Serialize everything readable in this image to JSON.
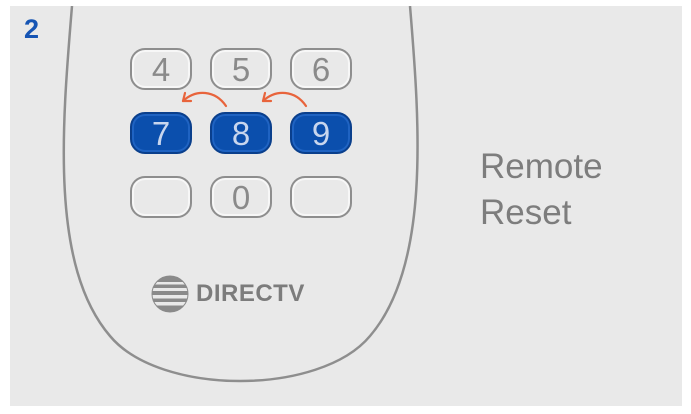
{
  "step": {
    "number": "2"
  },
  "keypad": {
    "rows": [
      [
        {
          "label": "4",
          "active": false
        },
        {
          "label": "5",
          "active": false
        },
        {
          "label": "6",
          "active": false
        }
      ],
      [
        {
          "label": "7",
          "active": true
        },
        {
          "label": "8",
          "active": true
        },
        {
          "label": "9",
          "active": true
        }
      ],
      [
        {
          "label": "",
          "active": false
        },
        {
          "label": "0",
          "active": false
        },
        {
          "label": "",
          "active": false
        }
      ]
    ]
  },
  "brand": {
    "name": "DIRECTV",
    "logo_icon": "att-globe-icon"
  },
  "caption": {
    "line1": "Remote",
    "line2": "Reset"
  },
  "colors": {
    "active_key": "#0b4fad",
    "step_number": "#1655b4",
    "arrow": "#e8643c",
    "panel": "#e9e9e9",
    "outline": "#8e8e8e"
  }
}
